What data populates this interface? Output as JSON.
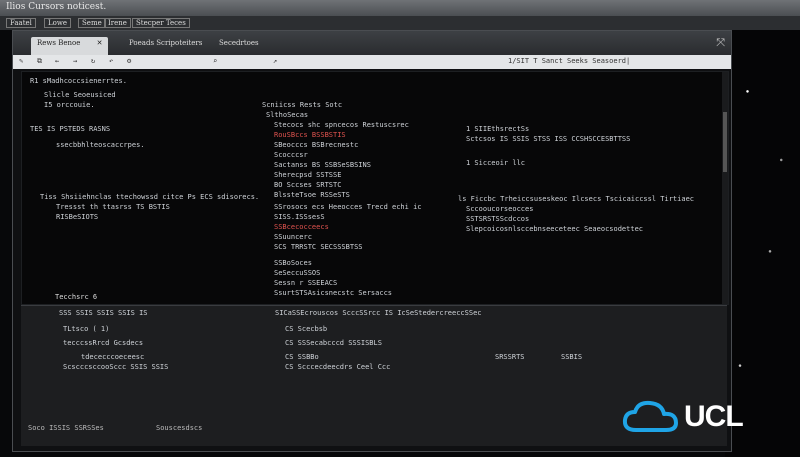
{
  "window": {
    "title": "Ilios Cursors noticest."
  },
  "menubar": [
    "Faatel",
    "Lowe",
    "Seme",
    "Irene",
    "Stecper Teces"
  ],
  "tabs": [
    "Rews Benoe",
    "Poeads Scripoteiters",
    "Secedrtoes"
  ],
  "toolbar": {
    "icons": [
      "pencil-icon",
      "copy-icon",
      "back-icon",
      "forward-icon",
      "refresh-icon",
      "undo-icon",
      "settings-icon"
    ],
    "addr": "1/SIT T  Sanct  Seeks Seasoerd|"
  },
  "upper": {
    "left": [
      "R1 sMadhcoccsienerrtes.",
      "Slicle Seoeusiced",
      "I5 orccouie.",
      "TES IS PSTEDS RASNS",
      "ssecbbhlteoscaccrpes.",
      "Tiss Shsiiehnclas ttechowssd citce Ps ECS sdisorecs.",
      "Tressst th ttasrss  TS BSTIS",
      "RISBeSIOTS"
    ],
    "center_head": "Scniicss Rests Sotc",
    "center": [
      "SlthoSecas",
      "Stecocs shc spncecos Restuscsrec",
      "RouSBccs BSSBSTIS",
      "SBeocccs BSBrecnestc",
      "Scocccsr",
      "Sactanss BS SSBSeSBSINS",
      "Sherecpsd SSTSSE",
      "BO Sccses SRTSTC",
      "BlssteTsoe RSSeSTS",
      "SSrosocs ecs Heeocces Trecd echi ic",
      "SISS.ISSsesS",
      "SSBcecocceecs",
      "SSuuncerc",
      "SCS TRRSTC SECSSSBTSS",
      "SSBoSoces",
      "SeSeccuSSOS",
      "Sessn r SSEEACS",
      "SsurtSTSAsicsnecstc Sersaccs"
    ],
    "right": [
      "1 SIIEthsrectSs",
      "Sctcsos IS SSIS STSS ISS CCSHSCCESBTTSS",
      "1 Sicceoir llc",
      "ls Ficcbc Trheiccsuseskeoc Ilcsecs Tscicaiccssl Tirtiaec",
      "Sccooucorseocces",
      "SSTSRSTSScdccos",
      "Slepcoicosnlsccebnseeceteec Seaeocsodettec"
    ]
  },
  "lower": {
    "title": "Tecchsrc  6",
    "left": [
      "SSS SSIS  SSIS  SSIS  IS",
      "TLtsco (  1)",
      "tecccssRrcd Gcsdecs",
      "tdececccoeceesc",
      "ScscccsccooSccc SSIS  SSIS"
    ],
    "center": [
      "SICaSSEcrouscos  ScccSSrcc  IS  IcSeStedercreeccSSec",
      "CS Scecbsb",
      "CS SSSecabcccd SSSISBLS",
      "CS SSBBo",
      "CS Scccecdeecdrs  Ceel  Ccc"
    ],
    "right": [
      "SRSSRTS",
      "SSBIS"
    ]
  },
  "status": {
    "left": "Soco  ISSIS SSRSSes",
    "right": "Souscesdscs"
  },
  "logo": {
    "text": "UCL"
  },
  "colors": {
    "accent": "#e0534f",
    "ok": "#8bc48b",
    "logo": "#1fa4e6"
  }
}
